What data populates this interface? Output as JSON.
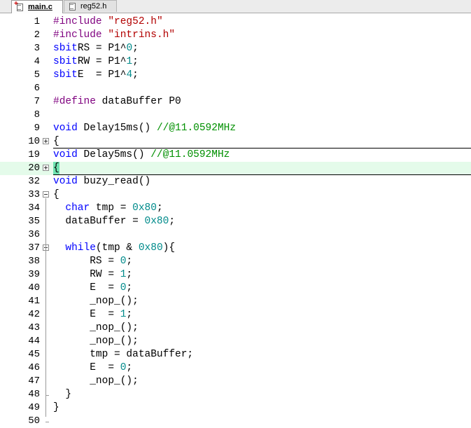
{
  "tabs": [
    {
      "label": "main.c",
      "active": true,
      "icon": "c-file-modified-icon"
    },
    {
      "label": "reg52.h",
      "active": false,
      "icon": "header-file-icon"
    }
  ],
  "colors": {
    "keyword": "#0000ff",
    "string": "#b20000",
    "number": "#008b8b",
    "comment": "#009000",
    "highlight": "#e4fbea"
  },
  "lines": [
    {
      "num": "1",
      "tokens": [
        [
          "pp",
          "#include "
        ],
        [
          "str",
          "\"reg52.h\""
        ]
      ]
    },
    {
      "num": "2",
      "tokens": [
        [
          "pp",
          "#include "
        ],
        [
          "str",
          "\"intrins.h\""
        ]
      ]
    },
    {
      "num": "3",
      "tokens": [
        [
          "kw",
          "sbit"
        ],
        [
          "",
          "RS = P1^"
        ],
        [
          "num",
          "0"
        ],
        [
          "",
          ";"
        ]
      ]
    },
    {
      "num": "4",
      "tokens": [
        [
          "kw",
          "sbit"
        ],
        [
          "",
          "RW = P1^"
        ],
        [
          "num",
          "1"
        ],
        [
          "",
          ";"
        ]
      ]
    },
    {
      "num": "5",
      "tokens": [
        [
          "kw",
          "sbit"
        ],
        [
          "",
          "E  = P1^"
        ],
        [
          "num",
          "4"
        ],
        [
          "",
          ";"
        ]
      ]
    },
    {
      "num": "6",
      "tokens": []
    },
    {
      "num": "7",
      "tokens": [
        [
          "pp",
          "#define "
        ],
        [
          "",
          "dataBuffer P0"
        ]
      ]
    },
    {
      "num": "8",
      "tokens": []
    },
    {
      "num": "9",
      "tokens": [
        [
          "kw",
          "void"
        ],
        [
          "",
          " Delay15ms() "
        ],
        [
          "cm",
          "//@11.0592MHz"
        ]
      ]
    },
    {
      "num": "10",
      "tokens": [
        [
          "",
          "{"
        ]
      ],
      "fold": "plus",
      "sep_after": true
    },
    {
      "num": "19",
      "tokens": [
        [
          "kw",
          "void"
        ],
        [
          "",
          " Delay5ms() "
        ],
        [
          "cm",
          "//@11.0592MHz"
        ]
      ]
    },
    {
      "num": "20",
      "tokens": [
        [
          "caret",
          "{"
        ]
      ],
      "fold": "plus",
      "highlight": true,
      "sep_after": true
    },
    {
      "num": "32",
      "tokens": [
        [
          "kw",
          "void"
        ],
        [
          "",
          " buzy_read()"
        ]
      ]
    },
    {
      "num": "33",
      "tokens": [
        [
          "",
          "{"
        ]
      ],
      "fold": "minus"
    },
    {
      "num": "34",
      "tokens": [
        [
          "",
          "  "
        ],
        [
          "kw",
          "char"
        ],
        [
          "",
          " tmp = "
        ],
        [
          "num",
          "0x80"
        ],
        [
          "",
          ";"
        ]
      ]
    },
    {
      "num": "35",
      "tokens": [
        [
          "",
          "  dataBuffer = "
        ],
        [
          "num",
          "0x80"
        ],
        [
          "",
          ";"
        ]
      ]
    },
    {
      "num": "36",
      "tokens": []
    },
    {
      "num": "37",
      "tokens": [
        [
          "",
          "  "
        ],
        [
          "kw",
          "while"
        ],
        [
          "",
          "(tmp & "
        ],
        [
          "num",
          "0x80"
        ],
        [
          "",
          "){"
        ]
      ],
      "fold": "minus"
    },
    {
      "num": "38",
      "tokens": [
        [
          "",
          "      RS = "
        ],
        [
          "num",
          "0"
        ],
        [
          "",
          ";"
        ]
      ]
    },
    {
      "num": "39",
      "tokens": [
        [
          "",
          "      RW = "
        ],
        [
          "num",
          "1"
        ],
        [
          "",
          ";"
        ]
      ]
    },
    {
      "num": "40",
      "tokens": [
        [
          "",
          "      E  = "
        ],
        [
          "num",
          "0"
        ],
        [
          "",
          ";"
        ]
      ]
    },
    {
      "num": "41",
      "tokens": [
        [
          "",
          "      _nop_();"
        ]
      ]
    },
    {
      "num": "42",
      "tokens": [
        [
          "",
          "      E  = "
        ],
        [
          "num",
          "1"
        ],
        [
          "",
          ";"
        ]
      ]
    },
    {
      "num": "43",
      "tokens": [
        [
          "",
          "      _nop_();"
        ]
      ]
    },
    {
      "num": "44",
      "tokens": [
        [
          "",
          "      _nop_();"
        ]
      ]
    },
    {
      "num": "45",
      "tokens": [
        [
          "",
          "      tmp = dataBuffer;"
        ]
      ]
    },
    {
      "num": "46",
      "tokens": [
        [
          "",
          "      E  = "
        ],
        [
          "num",
          "0"
        ],
        [
          "",
          ";"
        ]
      ]
    },
    {
      "num": "47",
      "tokens": [
        [
          "",
          "      _nop_();"
        ]
      ]
    },
    {
      "num": "48",
      "tokens": [
        [
          "",
          "  }"
        ]
      ]
    },
    {
      "num": "49",
      "tokens": [
        [
          "",
          "}"
        ]
      ]
    },
    {
      "num": "50",
      "tokens": []
    }
  ]
}
